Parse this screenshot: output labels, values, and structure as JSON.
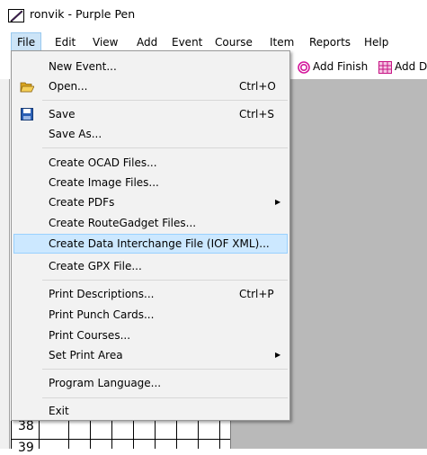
{
  "window": {
    "title": "ronvik - Purple Pen"
  },
  "menubar": {
    "items": [
      "File",
      "Edit",
      "View",
      "Add",
      "Event",
      "Course",
      "Item",
      "Reports",
      "Help"
    ]
  },
  "toolbar": {
    "add_finish": "Add Finish",
    "add_description_partial": "Add D"
  },
  "file_menu": {
    "new_event": "New Event...",
    "open": "Open...",
    "open_shortcut": "Ctrl+O",
    "save": "Save",
    "save_shortcut": "Ctrl+S",
    "save_as": "Save As...",
    "create_ocad": "Create OCAD Files...",
    "create_image": "Create Image Files...",
    "create_pdfs": "Create PDFs",
    "create_routegadget": "Create RouteGadget Files...",
    "create_data_interchange": "Create Data Interchange File (IOF XML)...",
    "create_gpx": "Create GPX File...",
    "print_descriptions": "Print Descriptions...",
    "print_descriptions_shortcut": "Ctrl+P",
    "print_punch_cards": "Print Punch Cards...",
    "print_courses": "Print Courses...",
    "set_print_area": "Set Print Area",
    "program_language": "Program Language...",
    "exit": "Exit"
  },
  "grid": {
    "row_38": "38",
    "row_39": "39"
  },
  "colors": {
    "highlight": "#cce8ff",
    "finish_icon": "#d4189c",
    "description_icon": "#c71585"
  }
}
